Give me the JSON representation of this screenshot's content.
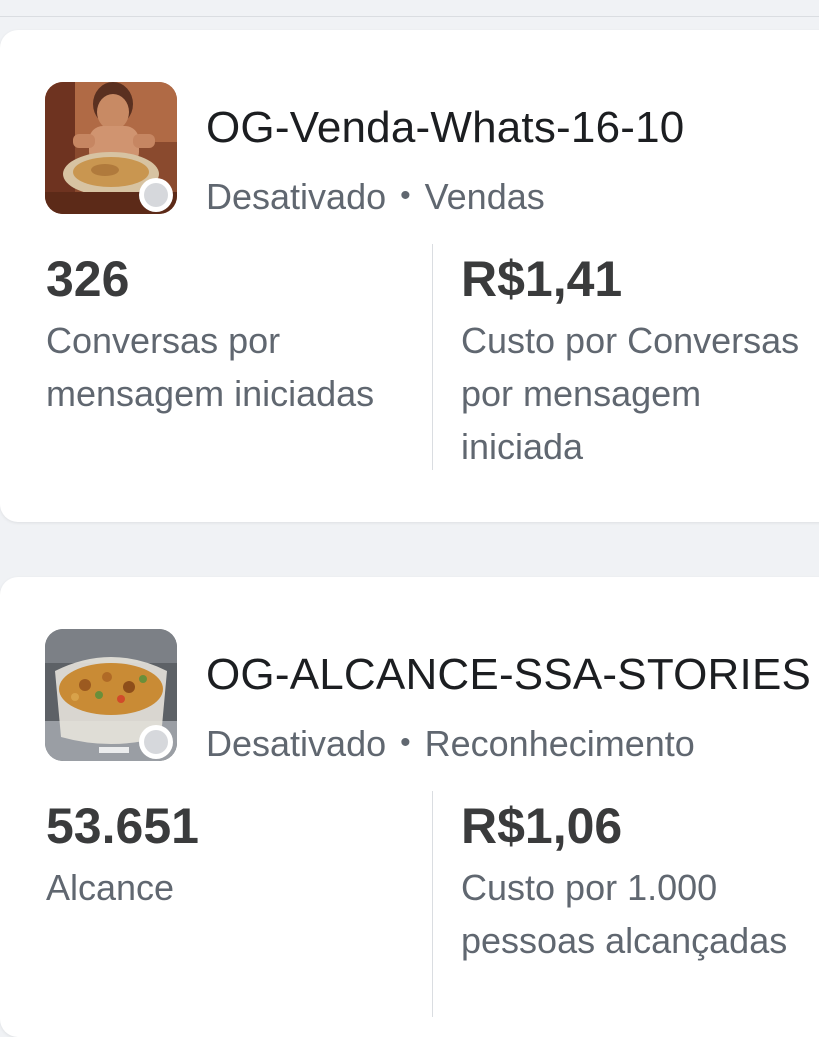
{
  "campaigns": [
    {
      "name": "OG-Venda-Whats-16-10",
      "status": "Desativado",
      "separator": "•",
      "objective": "Vendas",
      "metric_primary": {
        "value": "326",
        "label": "Conversas por\nmensagem iniciadas"
      },
      "metric_secondary": {
        "value": "R$1,41",
        "label": "Custo por Conversas\npor mensagem\niniciada"
      },
      "thumbnail_icon": "child-with-plate-photo"
    },
    {
      "name": "OG-ALCANCE-SSA-STORIES",
      "status": "Desativado",
      "separator": "•",
      "objective": "Reconhecimento",
      "metric_primary": {
        "value": "53.651",
        "label": "Alcance"
      },
      "metric_secondary": {
        "value": "R$1,06",
        "label": "Custo por 1.000\npessoas alcançadas"
      },
      "thumbnail_icon": "food-container-photo"
    }
  ],
  "colors": {
    "background": "#f0f2f5",
    "card": "#ffffff",
    "status_inactive": "#d6d8dc",
    "secondary_text": "#606770"
  }
}
